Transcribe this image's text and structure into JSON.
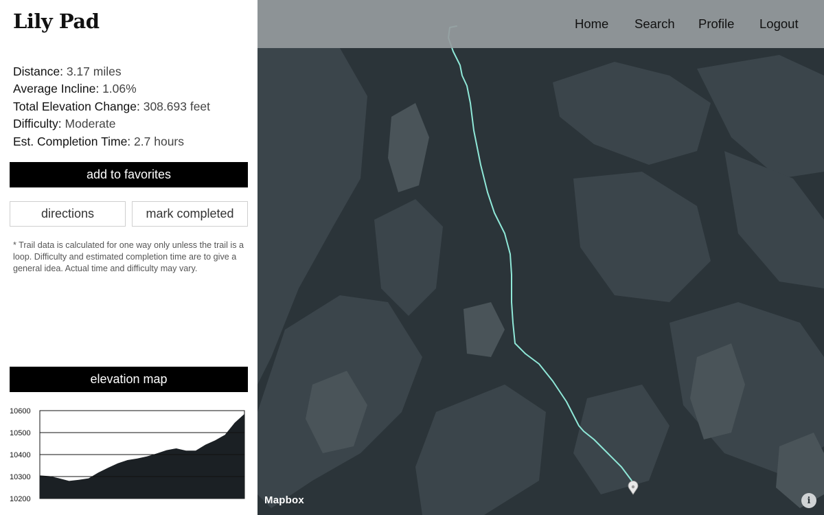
{
  "app": {
    "title": "Lily Pad"
  },
  "stats": [
    {
      "label": "Distance:",
      "value": "3.17 miles"
    },
    {
      "label": "Average Incline:",
      "value": "1.06%"
    },
    {
      "label": "Total Elevation Change:",
      "value": "308.693 feet"
    },
    {
      "label": "Difficulty:",
      "value": "Moderate"
    },
    {
      "label": "Est. Completion Time:",
      "value": "2.7 hours"
    }
  ],
  "buttons": {
    "favorites": "add to favorites",
    "directions": "directions",
    "completed": "mark completed"
  },
  "disclaimer": "* Trail data is calculated for one way only unless the trail is a loop. Difficulty and estimated completion time are to give a general idea. Actual time and difficulty may vary.",
  "elevation": {
    "header": "elevation map"
  },
  "chart_data": {
    "type": "area",
    "title": "",
    "xlabel": "",
    "ylabel": "",
    "ylim": [
      10200,
      10600
    ],
    "yticks": [
      10600,
      10500,
      10400,
      10300,
      10200
    ],
    "grid": true,
    "x": [
      0,
      5,
      10,
      15,
      20,
      25,
      30,
      35,
      40,
      45,
      50,
      55,
      60,
      65,
      70,
      75,
      80,
      85,
      90,
      95,
      100
    ],
    "values": [
      10305,
      10302,
      10292,
      10280,
      10285,
      10292,
      10318,
      10340,
      10360,
      10375,
      10382,
      10392,
      10405,
      10420,
      10428,
      10418,
      10418,
      10445,
      10465,
      10490,
      10545,
      10585
    ],
    "color": "#1b2024"
  },
  "nav": {
    "home": "Home",
    "search": "Search",
    "profile": "Profile",
    "logout": "Logout"
  },
  "map": {
    "attribution": "Mapbox",
    "info_icon": "info-icon",
    "trail_color": "#8fe8d8",
    "background_color": "#2b3439",
    "terrain_color": "#3e484e"
  }
}
